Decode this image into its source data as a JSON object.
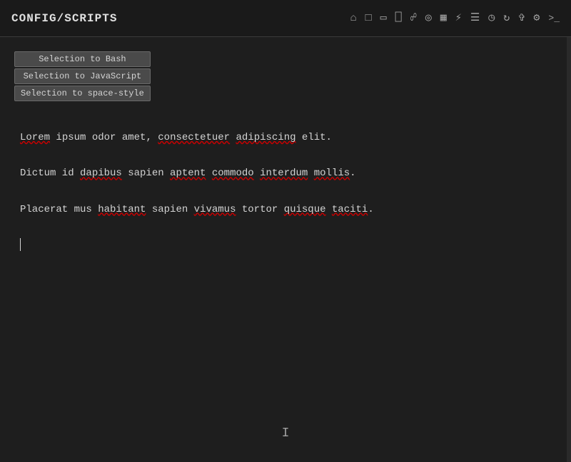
{
  "header": {
    "title": "CONFIG/SCRIPTS",
    "icons": [
      {
        "name": "home-icon",
        "symbol": "⌂"
      },
      {
        "name": "folder-icon",
        "symbol": "□"
      },
      {
        "name": "file-icon",
        "symbol": "▭"
      },
      {
        "name": "trash-icon",
        "symbol": "⊟"
      },
      {
        "name": "search-icon",
        "symbol": "⌕"
      },
      {
        "name": "eye-icon",
        "symbol": "◎"
      },
      {
        "name": "grid-icon",
        "symbol": "▦"
      },
      {
        "name": "bolt-icon",
        "symbol": "⚡"
      },
      {
        "name": "list-icon",
        "symbol": "☰"
      },
      {
        "name": "clock-icon",
        "symbol": "◷"
      },
      {
        "name": "refresh-icon",
        "symbol": "↻"
      },
      {
        "name": "columns-icon",
        "symbol": "⊞"
      },
      {
        "name": "settings-icon",
        "symbol": "⚙"
      },
      {
        "name": "terminal-icon",
        "symbol": ">_"
      }
    ]
  },
  "context_menu": {
    "items": [
      {
        "label": "Selection to Bash",
        "id": "selection-bash"
      },
      {
        "label": "Selection to JavaScript",
        "id": "selection-javascript"
      },
      {
        "label": "Selection to space-style",
        "id": "selection-space-style"
      }
    ]
  },
  "text_content": {
    "paragraphs": [
      {
        "id": "para1",
        "text": "Lorem ipsum odor amet, consectetuer adipiscing elit."
      },
      {
        "id": "para2",
        "text": "Dictum id dapibus sapien aptent commodo interdum mollis."
      },
      {
        "id": "para3",
        "text": "Placerat mus habitant sapien vivamus tortor quisque taciti."
      }
    ]
  },
  "ibeam": {
    "symbol": "I"
  }
}
